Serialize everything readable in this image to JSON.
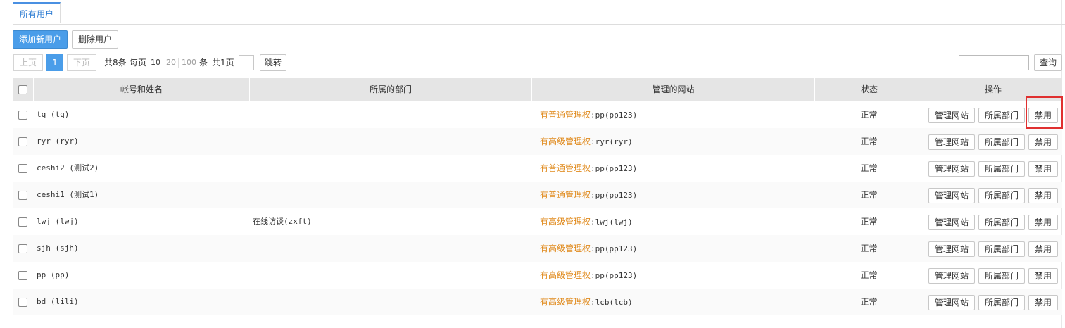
{
  "tabs": [
    {
      "label": "所有用户"
    }
  ],
  "toolbar": {
    "add_label": "添加新用户",
    "delete_label": "删除用户"
  },
  "pager": {
    "prev_label": "上页",
    "current_page": "1",
    "next_label": "下页",
    "total_text": "共8条",
    "per_page_label": "每页",
    "sizes": [
      "10",
      "20",
      "100"
    ],
    "unit_label": "条",
    "pages_text": "共1页",
    "jump_value": "",
    "jump_label": "跳转"
  },
  "search": {
    "value": "",
    "button_label": "查询"
  },
  "table": {
    "headers": {
      "account": "帐号和姓名",
      "department": "所属的部门",
      "sites": "管理的网站",
      "status": "状态",
      "actions": "操作"
    },
    "rows": [
      {
        "account": "tq (tq)",
        "department": "",
        "perm": "有普通管理权",
        "site": ":pp(pp123)",
        "status": "正常"
      },
      {
        "account": "ryr (ryr)",
        "department": "",
        "perm": "有高级管理权",
        "site": ":ryr(ryr)",
        "status": "正常"
      },
      {
        "account": "ceshi2 (测试2)",
        "department": "",
        "perm": "有普通管理权",
        "site": ":pp(pp123)",
        "status": "正常"
      },
      {
        "account": "ceshi1 (测试1)",
        "department": "",
        "perm": "有普通管理权",
        "site": ":pp(pp123)",
        "status": "正常"
      },
      {
        "account": "lwj (lwj)",
        "department": "在线访谈(zxft)",
        "perm": "有高级管理权",
        "site": ":lwj(lwj)",
        "status": "正常"
      },
      {
        "account": "sjh (sjh)",
        "department": "",
        "perm": "有高级管理权",
        "site": ":pp(pp123)",
        "status": "正常"
      },
      {
        "account": "pp (pp)",
        "department": "",
        "perm": "有高级管理权",
        "site": ":pp(pp123)",
        "status": "正常"
      },
      {
        "account": "bd (lili)",
        "department": "",
        "perm": "有高级管理权",
        "site": ":lcb(lcb)",
        "status": "正常"
      }
    ],
    "action_labels": {
      "manage_sites": "管理网站",
      "department": "所属部门",
      "disable": "禁用"
    }
  },
  "colors": {
    "accent": "#4a9de9",
    "perm": "#e08a1c",
    "highlight": "#e03030",
    "header_bg": "#e5e5e5"
  }
}
